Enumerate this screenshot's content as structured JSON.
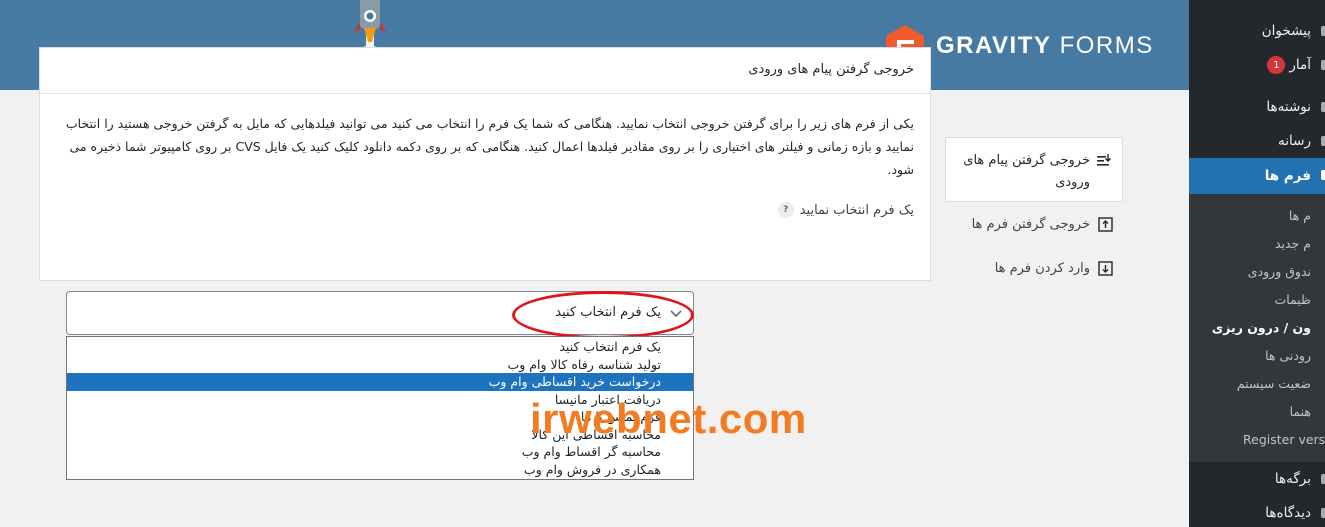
{
  "header": {
    "brand_bold": "GRAVITY",
    "brand_light": "FORMS"
  },
  "side_nav": {
    "active_label": "خروجی گرفتن پیام های ورودی",
    "export_forms_label": "خروجی گرفتن فرم ها",
    "import_forms_label": "وارد کردن فرم ها"
  },
  "panel": {
    "title": "خروجی گرفتن پیام های ورودی",
    "description": "یکی از فرم های زیر را برای گرفتن خروجی انتخاب نمایید. هنگامی که شما یک فرم را انتخاب می کنید می توانید فیلدهایی که مایل به گرفتن خروجی هستید را انتخاب نمایید و بازه زمانی و فیلتر های اختیاری را بر روی مقادیر فیلدها اعمال کنید. هنگامی که بر روی دکمه دانلود کلیک کنید یک فایل CVS بر روی کامپیوتر شما ذخیره می شود.",
    "field_label": "یک فرم انتخاب نمایید",
    "help_symbol": "?",
    "selected_value": "یک فرم انتخاب کنید"
  },
  "dropdown": {
    "options": [
      "یک فرم انتخاب کنید",
      "تولید شناسه رفاه کالا وام وب",
      "درخواست خرید اقساطی وام وب",
      "دریافت اعتبار مانیسا",
      "فرم تماس با ما",
      "محاسبه اقساطی این کالا",
      "محاسبه گر اقساط وام وب",
      "همکاری در فروش وام وب"
    ],
    "highlighted_index": 2
  },
  "watermark": "irwebnet.com",
  "wp_menu": {
    "items_top": [
      {
        "label": "پیشخوان"
      },
      {
        "label": "آمار",
        "badge": "1"
      }
    ],
    "posts": "نوشته‌ها",
    "media": "رسانه",
    "forms": "فرم ها",
    "submenu": [
      "م ها",
      "م جدید",
      "ندوق ورودی",
      "ظیمات",
      "ون / درون ریزی",
      "رودنی ها",
      "ضعیت سیستم",
      "هنما",
      "Register version"
    ],
    "submenu_current_index": 4,
    "pages": "برگه‌ها",
    "comments": "دیدگاه‌ها"
  },
  "colors": {
    "header_bg": "#467aa2",
    "accent": "#f15a2b",
    "wp_menu_bg": "#23282d",
    "wp_current": "#2271b1",
    "highlight": "#1e73be",
    "watermark": "#f47b20",
    "annotation": "#e0141e"
  }
}
